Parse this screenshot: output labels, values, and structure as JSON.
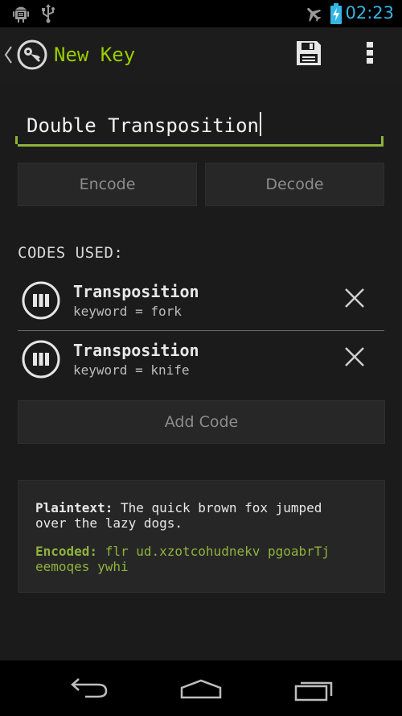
{
  "status_bar": {
    "time": "02:23",
    "icons": [
      "android-debug-icon",
      "usb-icon",
      "airplane-mode-icon",
      "battery-charging-icon"
    ],
    "accent": "#33b5e5"
  },
  "action_bar": {
    "title": "New Key",
    "title_color": "#99cc00",
    "icons": [
      "up-caret-icon",
      "key-logo-icon",
      "save-icon",
      "overflow-menu-icon"
    ]
  },
  "key_name": {
    "value": "Double Transposition"
  },
  "buttons": {
    "encode": "Encode",
    "decode": "Decode",
    "add_code": "Add Code"
  },
  "codes_section": {
    "label": "CODES USED:",
    "items": [
      {
        "name": "Transposition",
        "param": "keyword = fork"
      },
      {
        "name": "Transposition",
        "param": "keyword = knife"
      }
    ]
  },
  "summary": {
    "plaintext_label": "Plaintext:",
    "plaintext_value": " The quick brown fox jumped over the lazy dogs.",
    "encoded_label": "Encoded:",
    "encoded_value": " flr ud.xzotcohudnekv pgoabrTj eemoqes ywhi",
    "encoded_color": "#8fb33c"
  },
  "nav_bar": {
    "icons": [
      "back-icon",
      "home-icon",
      "recent-apps-icon"
    ]
  }
}
